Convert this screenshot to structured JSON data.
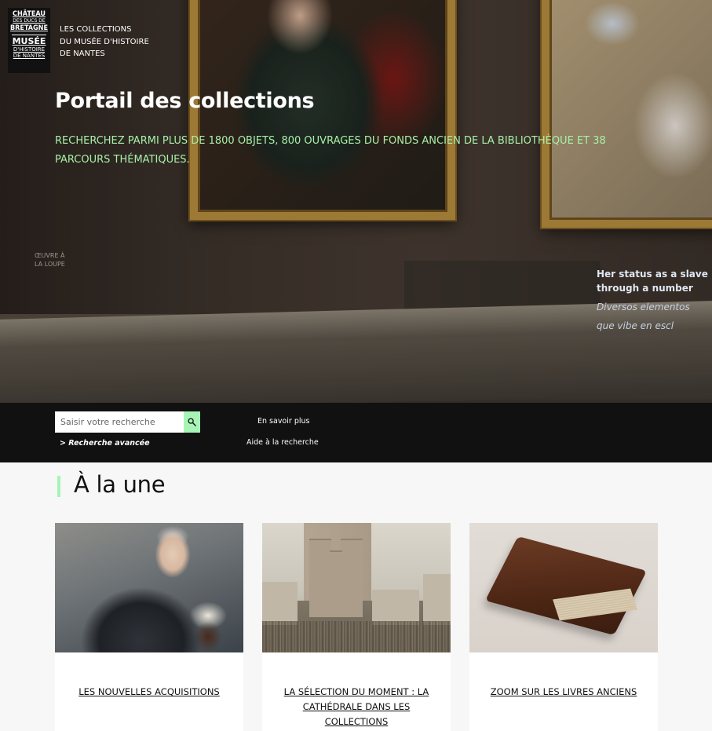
{
  "header": {
    "logo": {
      "line1": "CHÂTEAU",
      "line2": "DES DUCS DE",
      "line3": "BRETAGNE",
      "line4": "MUSÉE",
      "line5": "D'HISTOIRE",
      "line6": "DE NANTES"
    },
    "logo_text": [
      "LES COLLECTIONS",
      "DU MUSÉE D'HISTOIRE",
      "DE NANTES"
    ]
  },
  "hero": {
    "title": "Portail des collections",
    "subtitle": "RECHERCHEZ PARMI PLUS DE 1800 OBJETS, 800 OUVRAGES DU FONDS ANCIEN DE LA BIBLIOTHÈQUE ET 38 PARCOURS THÉMATIQUES.",
    "museum_sign_line1": "Her status as a slave",
    "museum_sign_line2": "through a number",
    "museum_sign_line3": "Diversos elementos",
    "museum_sign_line4": "que vibe en escl",
    "left_sign": "ŒUVRE À LA LOUPE"
  },
  "search": {
    "placeholder": "Saisir votre recherche",
    "advanced_label": "> Recherche avancée",
    "learn_more": "En savoir plus",
    "help": "Aide à la recherche",
    "button_icon": "search-icon"
  },
  "section": {
    "title": "À la une"
  },
  "cards": [
    {
      "caption": "LES NOUVELLES ACQUISITIONS"
    },
    {
      "caption": "LA SÉLECTION DU MOMENT : LA CATHÉDRALE DANS LES COLLECTIONS"
    },
    {
      "caption": "ZOOM SUR LES LIVRES ANCIENS"
    }
  ],
  "colors": {
    "accent": "#a6f5b6",
    "subtitle": "#a8f0a8",
    "bar": "#111111"
  }
}
